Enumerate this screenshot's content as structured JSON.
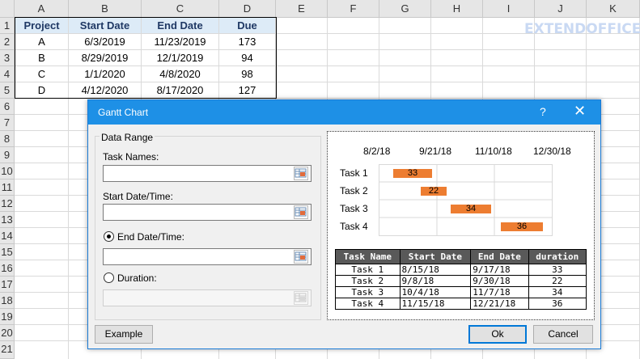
{
  "spreadsheet": {
    "columns": [
      "A",
      "B",
      "C",
      "D",
      "E",
      "F",
      "G",
      "H",
      "I",
      "J",
      "K"
    ],
    "rows": [
      "1",
      "2",
      "3",
      "4",
      "5",
      "6",
      "7",
      "8",
      "9",
      "10",
      "11",
      "12",
      "13",
      "14",
      "15",
      "16",
      "17",
      "18",
      "19",
      "20",
      "21"
    ],
    "headers": [
      "Project",
      "Start Date",
      "End Date",
      "Due"
    ],
    "data": [
      [
        "A",
        "6/3/2019",
        "11/23/2019",
        "173"
      ],
      [
        "B",
        "8/29/2019",
        "12/1/2019",
        "94"
      ],
      [
        "C",
        "1/1/2020",
        "4/8/2020",
        "98"
      ],
      [
        "D",
        "4/12/2020",
        "8/17/2020",
        "127"
      ]
    ],
    "watermark": "EXTENDOFFICE"
  },
  "dialog": {
    "title": "Gantt Chart",
    "help_icon": "?",
    "close_icon": "✕",
    "group_label": "Data Range",
    "task_names_label": "Task Names:",
    "start_label": "Start Date/Time:",
    "end_label": "End Date/Time:",
    "duration_label": "Duration:",
    "end_selected": true,
    "example_label": "Example",
    "ok_label": "Ok",
    "cancel_label": "Cancel"
  },
  "preview": {
    "axis_dates": [
      "8/2/18",
      "9/21/18",
      "11/10/18",
      "12/30/18"
    ],
    "tasks": [
      {
        "name": "Task 1",
        "value": "33"
      },
      {
        "name": "Task 2",
        "value": "22"
      },
      {
        "name": "Task 3",
        "value": "34"
      },
      {
        "name": "Task 4",
        "value": "36"
      }
    ],
    "bar_color": "#ed7d31",
    "table_headers": [
      "Task Name",
      "Start Date",
      "End Date",
      "duration"
    ],
    "table_rows": [
      [
        "Task 1",
        "8/15/18",
        "9/17/18",
        "33"
      ],
      [
        "Task 2",
        "9/8/18",
        "9/30/18",
        "22"
      ],
      [
        "Task 3",
        "10/4/18",
        "11/7/18",
        "34"
      ],
      [
        "Task 4",
        "11/15/18",
        "12/21/18",
        "36"
      ]
    ]
  }
}
